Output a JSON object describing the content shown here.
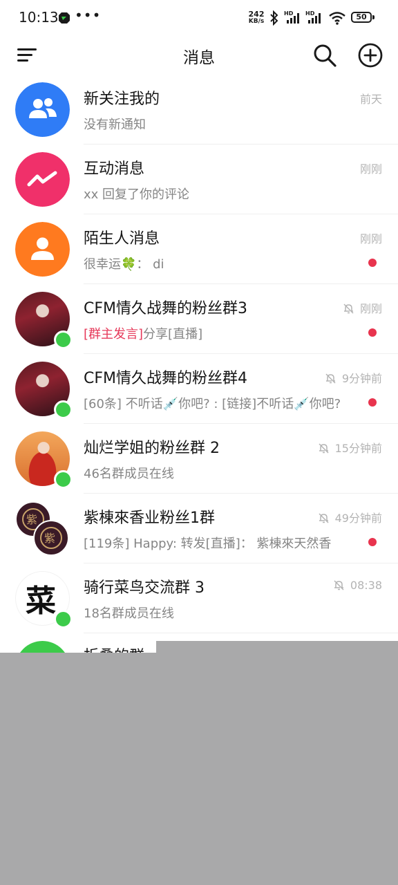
{
  "status_bar": {
    "time": "10:13",
    "dots": "•••",
    "speed_value": "242",
    "speed_unit": "KB/s",
    "signal_badge": "HD",
    "battery": "50"
  },
  "header": {
    "title": "消息"
  },
  "conversations": [
    {
      "title": "新关注我的",
      "preview": "没有新通知",
      "time": "前天",
      "muted": false,
      "unread": false
    },
    {
      "title": "互动消息",
      "preview": "xx 回复了你的评论",
      "time": "刚刚",
      "muted": false,
      "unread": false
    },
    {
      "title": "陌生人消息",
      "preview": "很幸运🍀： di",
      "time": "刚刚",
      "muted": false,
      "unread": true
    },
    {
      "title": "CFM情久战舞的粉丝群3",
      "preview_highlight": "[群主发言]",
      "preview": "分享[直播]",
      "time": "刚刚",
      "muted": true,
      "unread": true
    },
    {
      "title": "CFM情久战舞的粉丝群4",
      "preview": "[60条] 不听话💉你吧? : [链接]不听话💉你吧?",
      "time": "9分钟前",
      "muted": true,
      "unread": true
    },
    {
      "title": "灿烂学姐的粉丝群 2",
      "preview": "46名群成员在线",
      "time": "15分钟前",
      "muted": true,
      "unread": false
    },
    {
      "title": "紫棟來香业粉丝1群",
      "preview": "[119条] Happy: 转发[直播]： 紫棟來天然香",
      "time": "49分钟前",
      "muted": true,
      "unread": true
    },
    {
      "title": "骑行菜鸟交流群 3",
      "preview": "18名群成员在线",
      "time": "08:38",
      "muted": true,
      "unread": false
    }
  ],
  "folded_group": {
    "title": "折叠的群"
  },
  "avatar_texts": {
    "seal_char": "紫",
    "calligraphy_char": "菜"
  },
  "colors": {
    "followers_avatar": "#2f7cf6",
    "interaction_avatar": "#f0306a",
    "stranger_avatar": "#ff7a1f",
    "online_dot": "#3ccb4a",
    "unread_dot": "#e8344e",
    "highlight_text": "#e6395a",
    "overlay_gray": "#a9a9aa"
  }
}
